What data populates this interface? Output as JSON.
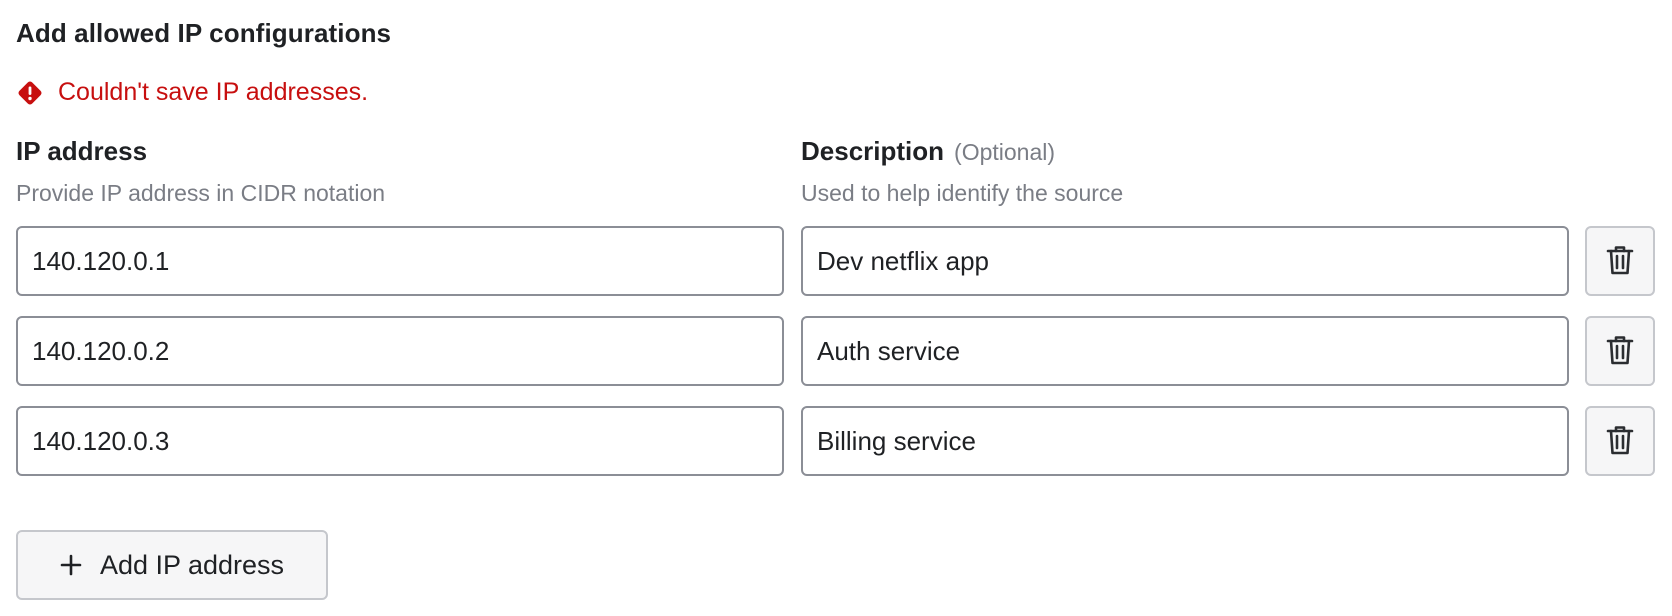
{
  "section": {
    "title": "Add allowed IP configurations"
  },
  "error": {
    "message": "Couldn't save IP addresses.",
    "icon": "error-diamond-icon",
    "color": "#c70f0f"
  },
  "columns": {
    "ip": {
      "label": "IP address",
      "help": "Provide IP address in CIDR notation"
    },
    "description": {
      "label": "Description",
      "optional": "(Optional)",
      "help": "Used to help identify the source"
    }
  },
  "rows": [
    {
      "ip": "140.120.0.1",
      "description": "Dev netflix app",
      "delete_icon": "trash-icon"
    },
    {
      "ip": "140.120.0.2",
      "description": "Auth service",
      "delete_icon": "trash-icon"
    },
    {
      "ip": "140.120.0.3",
      "description": "Billing service",
      "delete_icon": "trash-icon"
    }
  ],
  "add_button": {
    "label": "Add IP address",
    "icon": "plus-icon"
  }
}
